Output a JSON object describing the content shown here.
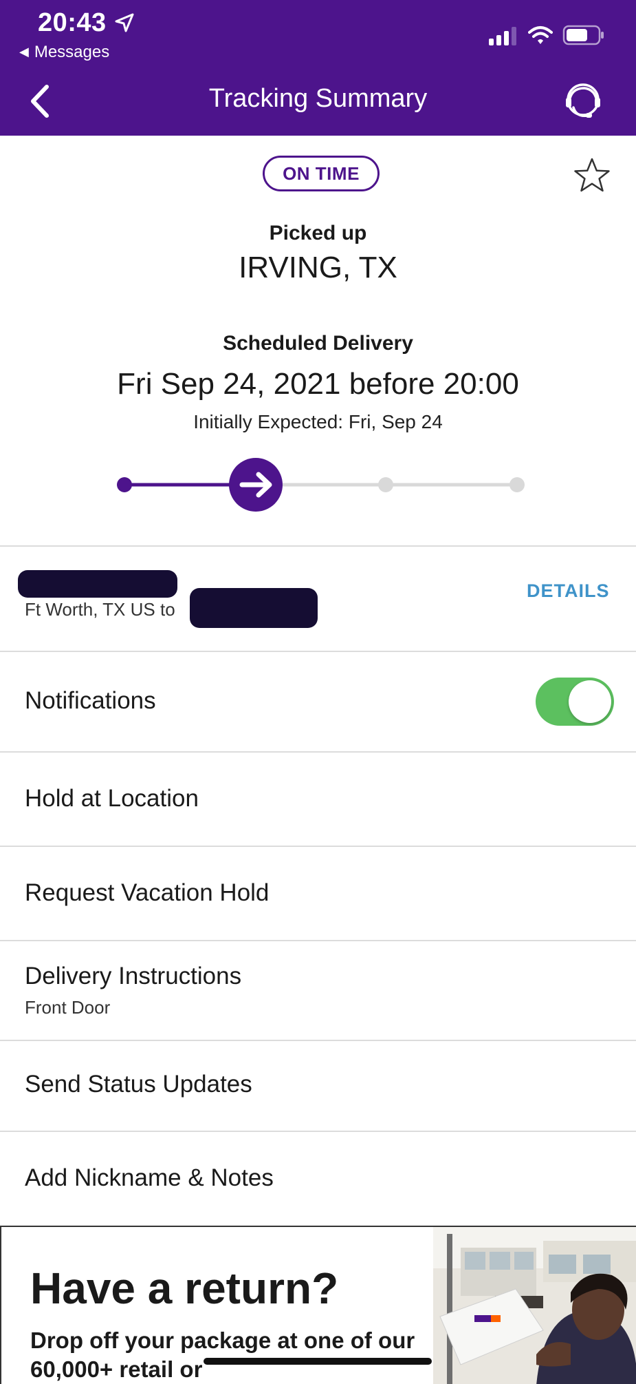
{
  "status_bar": {
    "time": "20:43",
    "back_app": "Messages"
  },
  "nav": {
    "title": "Tracking Summary"
  },
  "summary": {
    "status_badge": "ON TIME",
    "picked_label": "Picked up",
    "picked_location": "IRVING, TX",
    "scheduled_label": "Scheduled Delivery",
    "scheduled_date": "Fri Sep 24, 2021 before 20:00",
    "initially_expected": "Initially Expected: Fri, Sep 24",
    "progress_step": 2,
    "progress_total": 4
  },
  "shipment": {
    "route_text": "Ft Worth, TX US to",
    "details_label": "DETAILS"
  },
  "list": {
    "notifications": "Notifications",
    "notifications_on": true,
    "hold_at_location": "Hold at Location",
    "vacation_hold": "Request Vacation Hold",
    "delivery_instructions": "Delivery Instructions",
    "delivery_instructions_value": "Front Door",
    "send_status": "Send Status Updates",
    "nickname": "Add Nickname & Notes"
  },
  "promo": {
    "title": "Have a return?",
    "text": "Drop off your package at one of our 60,000+ retail or"
  },
  "colors": {
    "brand_purple": "#4d148c",
    "toggle_green": "#5cc05f",
    "link_blue": "#3f93c9"
  }
}
